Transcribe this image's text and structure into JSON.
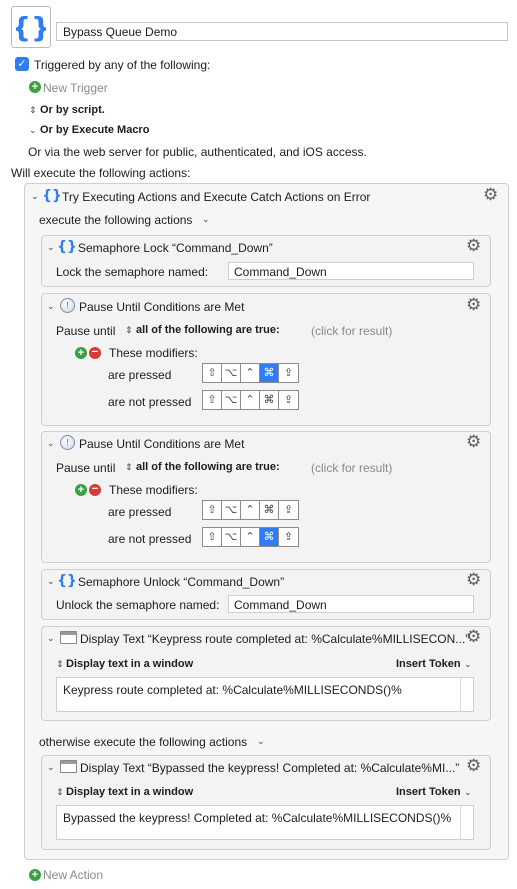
{
  "macro": {
    "name": "Bypass Queue Demo",
    "icon": "curly-braces-icon"
  },
  "trigger": {
    "triggered_label": "Triggered by any of the following:",
    "new_trigger": "New Trigger",
    "or_by_script": "Or by script.",
    "or_by_execute_macro": "Or by Execute Macro",
    "web_server": "Or via the web server for public, authenticated, and iOS access."
  },
  "will_execute": "Will execute the following actions:",
  "try_action": {
    "title": "Try Executing Actions and Execute Catch Actions on Error",
    "execute_label": "execute the following actions",
    "otherwise_label": "otherwise execute the following actions"
  },
  "lock": {
    "title": "Semaphore Lock “Command_Down”",
    "label": "Lock the semaphore named:",
    "value": "Command_Down"
  },
  "pause1": {
    "title": "Pause Until Conditions are Met",
    "pause_until": "Pause until",
    "condition": "all of the following are true:",
    "result": "(click for result)",
    "modifiers": "These modifiers:",
    "pressed": "are pressed",
    "not_pressed": "are not pressed"
  },
  "pause2": {
    "title": "Pause Until Conditions are Met",
    "pause_until": "Pause until",
    "condition": "all of the following are true:",
    "result": "(click for result)",
    "modifiers": "These modifiers:",
    "pressed": "are pressed",
    "not_pressed": "are not pressed"
  },
  "modifier_keys": [
    "⇧",
    "⌥",
    "⌃",
    "⌘",
    "⇪"
  ],
  "unlock": {
    "title": "Semaphore Unlock “Command_Down”",
    "label": "Unlock the semaphore named:",
    "value": "Command_Down"
  },
  "display1": {
    "title": "Display Text “Keypress route completed at: %Calculate%MILLISECON...”",
    "mode": "Display text in a window",
    "insert_token": "Insert Token",
    "text": "Keypress route completed at: %Calculate%MILLISECONDS()%"
  },
  "display2": {
    "title": "Display Text “Bypassed the keypress! Completed at: %Calculate%MI...”",
    "mode": "Display text in a window",
    "insert_token": "Insert Token",
    "text": "Bypassed the keypress! Completed at: %Calculate%MILLISECONDS()%"
  },
  "new_action": "New Action",
  "colors": {
    "accent": "#2f7cf6",
    "green": "#3aa143",
    "red": "#d63a3a"
  }
}
